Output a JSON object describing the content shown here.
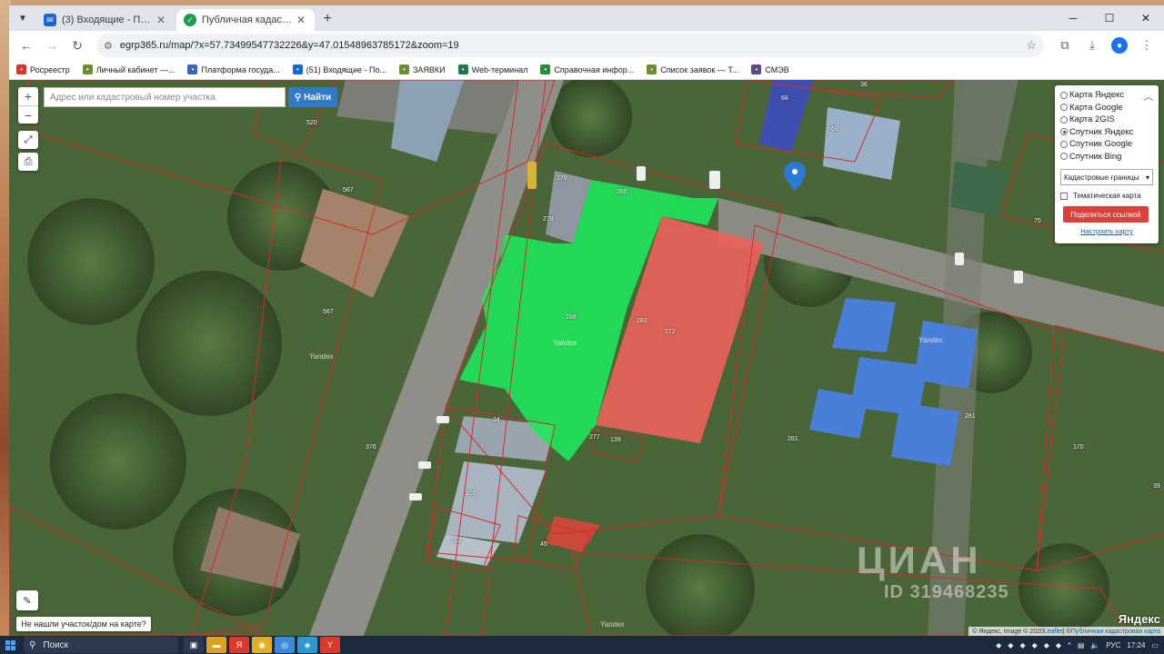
{
  "browser": {
    "tabs": [
      {
        "title": "(3) Входящие - Почта Mail.ru",
        "icon": "mail-icon",
        "active": false
      },
      {
        "title": "Публичная кадастровая карта",
        "icon": "check-shield-icon",
        "active": true
      }
    ],
    "new_tab_label": "+",
    "url": "egrp365.ru/map/?x=57.73499547732226&y=47.01548963785172&zoom=19",
    "bookmarks": [
      {
        "label": "Росреестр",
        "icon": "emblem-icon",
        "color": "#d4392c"
      },
      {
        "label": "Личный кабинет —...",
        "icon": "gosuslugi-icon",
        "color": "#6b8f2a"
      },
      {
        "label": "Платформа госуда...",
        "icon": "emblem-icon",
        "color": "#3a64b8"
      },
      {
        "label": "(51) Входящие - По...",
        "icon": "mail-icon",
        "color": "#1966d2"
      },
      {
        "label": "ЗАЯВКИ",
        "icon": "gosuslugi-icon",
        "color": "#6b8f2a"
      },
      {
        "label": "Web-терминал",
        "icon": "web-terminal-icon",
        "color": "#1f7a4a"
      },
      {
        "label": "Справочная инфор...",
        "icon": "tree-icon",
        "color": "#2e8a3c"
      },
      {
        "label": "Список заявок — Т...",
        "icon": "gosuslugi-icon",
        "color": "#6b8f2a"
      },
      {
        "label": "СМЭВ",
        "icon": "diamond-icon",
        "color": "#5a4a8a"
      }
    ]
  },
  "map": {
    "search": {
      "placeholder": "Адрес или кадастровый номер участка",
      "button_label": "Найти"
    },
    "zoom_in": "+",
    "zoom_out": "−",
    "layers": {
      "options": [
        {
          "label": "Карта Яндекс",
          "selected": false
        },
        {
          "label": "Карта Google",
          "selected": false
        },
        {
          "label": "Карта 2GIS",
          "selected": false
        },
        {
          "label": "Спутник Яндекс",
          "selected": true
        },
        {
          "label": "Спутник Google",
          "selected": false
        },
        {
          "label": "Спутник Bing",
          "selected": false
        }
      ],
      "boundaries_select": "Кадастровые границы",
      "thematic_label": "Тематическая карта",
      "share_button": "Поделиться ссылкой",
      "setup_link": "Настроить карту"
    },
    "not_found_label": "Не нашли участок/дом на карте?",
    "yandex_logo": "Яндекс",
    "attribution": {
      "text": "© Яндекс, Image © 2020 ",
      "leaflet": "Leaflet",
      "separator": " | © ",
      "public_map": "Публичная кадастровая карта"
    },
    "watermark": {
      "main": "ЦИАН",
      "id": "ID 319468235"
    },
    "plot_labels": [
      {
        "text": "520"
      },
      {
        "text": "567"
      },
      {
        "text": "567"
      },
      {
        "text": "376"
      },
      {
        "text": "278"
      },
      {
        "text": "278"
      },
      {
        "text": "288"
      },
      {
        "text": "282"
      },
      {
        "text": "272"
      },
      {
        "text": "34"
      },
      {
        "text": "7"
      },
      {
        "text": "101"
      },
      {
        "text": "102"
      },
      {
        "text": "45"
      },
      {
        "text": "139"
      },
      {
        "text": "277"
      },
      {
        "text": "68"
      },
      {
        "text": "69"
      },
      {
        "text": "36"
      },
      {
        "text": "75"
      },
      {
        "text": "281"
      },
      {
        "text": "281"
      },
      {
        "text": "170"
      },
      {
        "text": "39"
      },
      {
        "text": "288"
      }
    ],
    "yandex_labels": [
      "Yandex",
      "Yandex",
      "Yandex",
      "Yandex"
    ]
  },
  "taskbar": {
    "search_label": "Поиск",
    "language": "РУС",
    "time": "17:24"
  },
  "colors": {
    "selected_parcel": "#1ee85a",
    "building_red": "#e8625a",
    "boundary": "#d62a2a",
    "roof_blue": "#4a7fd9",
    "search_button": "#3279c9",
    "share_button": "#d9413b"
  }
}
